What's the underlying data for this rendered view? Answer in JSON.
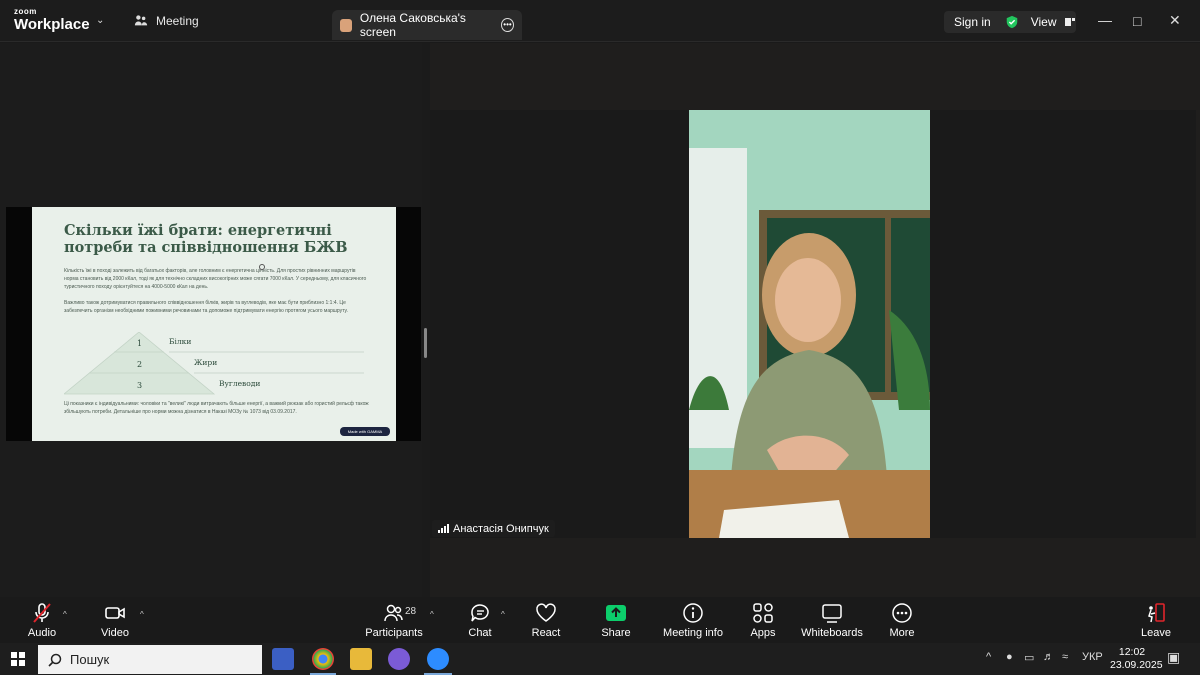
{
  "titlebar": {
    "brand_top": "zoom",
    "brand_bottom": "Workplace",
    "meeting_label": "Meeting",
    "share_tab_label": "Олена Саковська's screen",
    "sign_in_label": "Sign in",
    "view_label": "View"
  },
  "slide": {
    "title": "Скільки їжі брати: енергетичні потреби та співвідношення БЖВ",
    "paragraph1": "Кількість їжі в поході залежить від багатьох факторів, але головним є енергетична цінність. Для простих рівнинних маршрутів норма становить від 2000 кКал, тоді як для технічно складних високогірних може сягати 7000 кКал. У середньому, для класичного туристичного походу орієнтуйтеся на 4000-5000 кКал на день.",
    "paragraph2": "Важливо також дотримуватися правильного співвідношення білків, жирів та вуглеводів, яке має бути приблизно 1:1:4. Це забезпечить організм необхідними поживними речовинами та допоможе підтримувати енергію протягом усього маршруту.",
    "pyramid": [
      {
        "num": "1",
        "label": "Білки"
      },
      {
        "num": "2",
        "label": "Жири"
      },
      {
        "num": "3",
        "label": "Вуглеводи"
      }
    ],
    "paragraph3": "Ці показники є індивідуальними: чоловіки та \"великі\" люди витрачають більше енергії, а важкий рюкзак або гористий рельєф також збільшують потреби. Детальніше про норми можна дізнатися в Наказі МОЗу № 1073 від 03.09.2017.",
    "badge": "Made with GAMMA"
  },
  "video": {
    "participant_name": "Анастасія Онипчук"
  },
  "toolbar": {
    "audio": "Audio",
    "video": "Video",
    "participants": "Participants",
    "participants_count": "28",
    "chat": "Chat",
    "react": "React",
    "share": "Share",
    "meeting_info": "Meeting info",
    "apps": "Apps",
    "whiteboards": "Whiteboards",
    "more": "More",
    "leave": "Leave"
  },
  "taskbar": {
    "search_placeholder": "Пошук",
    "language": "УКР",
    "time": "12:02",
    "date": "23.09.2025"
  },
  "colors": {
    "share_green": "#0cce6b",
    "leave_red": "#e0242b",
    "shield_green": "#22c55e",
    "slide_bg": "#e9f0ea"
  }
}
